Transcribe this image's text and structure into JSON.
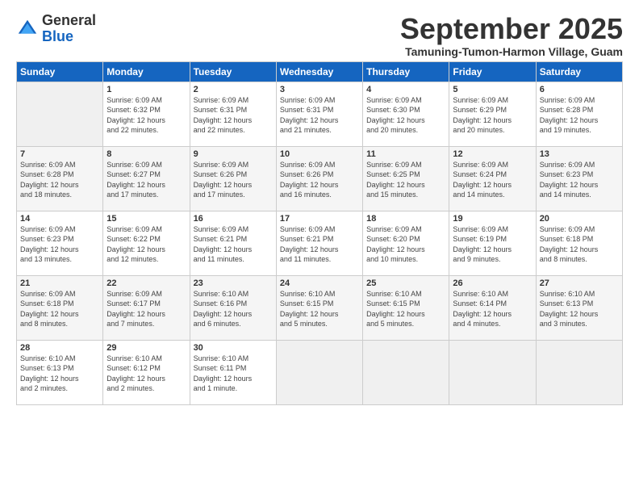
{
  "logo": {
    "general": "General",
    "blue": "Blue"
  },
  "header": {
    "month": "September 2025",
    "location": "Tamuning-Tumon-Harmon Village, Guam"
  },
  "days_of_week": [
    "Sunday",
    "Monday",
    "Tuesday",
    "Wednesday",
    "Thursday",
    "Friday",
    "Saturday"
  ],
  "weeks": [
    [
      {
        "day": "",
        "info": ""
      },
      {
        "day": "1",
        "info": "Sunrise: 6:09 AM\nSunset: 6:32 PM\nDaylight: 12 hours\nand 22 minutes."
      },
      {
        "day": "2",
        "info": "Sunrise: 6:09 AM\nSunset: 6:31 PM\nDaylight: 12 hours\nand 22 minutes."
      },
      {
        "day": "3",
        "info": "Sunrise: 6:09 AM\nSunset: 6:31 PM\nDaylight: 12 hours\nand 21 minutes."
      },
      {
        "day": "4",
        "info": "Sunrise: 6:09 AM\nSunset: 6:30 PM\nDaylight: 12 hours\nand 20 minutes."
      },
      {
        "day": "5",
        "info": "Sunrise: 6:09 AM\nSunset: 6:29 PM\nDaylight: 12 hours\nand 20 minutes."
      },
      {
        "day": "6",
        "info": "Sunrise: 6:09 AM\nSunset: 6:28 PM\nDaylight: 12 hours\nand 19 minutes."
      }
    ],
    [
      {
        "day": "7",
        "info": "Sunrise: 6:09 AM\nSunset: 6:28 PM\nDaylight: 12 hours\nand 18 minutes."
      },
      {
        "day": "8",
        "info": "Sunrise: 6:09 AM\nSunset: 6:27 PM\nDaylight: 12 hours\nand 17 minutes."
      },
      {
        "day": "9",
        "info": "Sunrise: 6:09 AM\nSunset: 6:26 PM\nDaylight: 12 hours\nand 17 minutes."
      },
      {
        "day": "10",
        "info": "Sunrise: 6:09 AM\nSunset: 6:26 PM\nDaylight: 12 hours\nand 16 minutes."
      },
      {
        "day": "11",
        "info": "Sunrise: 6:09 AM\nSunset: 6:25 PM\nDaylight: 12 hours\nand 15 minutes."
      },
      {
        "day": "12",
        "info": "Sunrise: 6:09 AM\nSunset: 6:24 PM\nDaylight: 12 hours\nand 14 minutes."
      },
      {
        "day": "13",
        "info": "Sunrise: 6:09 AM\nSunset: 6:23 PM\nDaylight: 12 hours\nand 14 minutes."
      }
    ],
    [
      {
        "day": "14",
        "info": "Sunrise: 6:09 AM\nSunset: 6:23 PM\nDaylight: 12 hours\nand 13 minutes."
      },
      {
        "day": "15",
        "info": "Sunrise: 6:09 AM\nSunset: 6:22 PM\nDaylight: 12 hours\nand 12 minutes."
      },
      {
        "day": "16",
        "info": "Sunrise: 6:09 AM\nSunset: 6:21 PM\nDaylight: 12 hours\nand 11 minutes."
      },
      {
        "day": "17",
        "info": "Sunrise: 6:09 AM\nSunset: 6:21 PM\nDaylight: 12 hours\nand 11 minutes."
      },
      {
        "day": "18",
        "info": "Sunrise: 6:09 AM\nSunset: 6:20 PM\nDaylight: 12 hours\nand 10 minutes."
      },
      {
        "day": "19",
        "info": "Sunrise: 6:09 AM\nSunset: 6:19 PM\nDaylight: 12 hours\nand 9 minutes."
      },
      {
        "day": "20",
        "info": "Sunrise: 6:09 AM\nSunset: 6:18 PM\nDaylight: 12 hours\nand 8 minutes."
      }
    ],
    [
      {
        "day": "21",
        "info": "Sunrise: 6:09 AM\nSunset: 6:18 PM\nDaylight: 12 hours\nand 8 minutes."
      },
      {
        "day": "22",
        "info": "Sunrise: 6:09 AM\nSunset: 6:17 PM\nDaylight: 12 hours\nand 7 minutes."
      },
      {
        "day": "23",
        "info": "Sunrise: 6:10 AM\nSunset: 6:16 PM\nDaylight: 12 hours\nand 6 minutes."
      },
      {
        "day": "24",
        "info": "Sunrise: 6:10 AM\nSunset: 6:15 PM\nDaylight: 12 hours\nand 5 minutes."
      },
      {
        "day": "25",
        "info": "Sunrise: 6:10 AM\nSunset: 6:15 PM\nDaylight: 12 hours\nand 5 minutes."
      },
      {
        "day": "26",
        "info": "Sunrise: 6:10 AM\nSunset: 6:14 PM\nDaylight: 12 hours\nand 4 minutes."
      },
      {
        "day": "27",
        "info": "Sunrise: 6:10 AM\nSunset: 6:13 PM\nDaylight: 12 hours\nand 3 minutes."
      }
    ],
    [
      {
        "day": "28",
        "info": "Sunrise: 6:10 AM\nSunset: 6:13 PM\nDaylight: 12 hours\nand 2 minutes."
      },
      {
        "day": "29",
        "info": "Sunrise: 6:10 AM\nSunset: 6:12 PM\nDaylight: 12 hours\nand 2 minutes."
      },
      {
        "day": "30",
        "info": "Sunrise: 6:10 AM\nSunset: 6:11 PM\nDaylight: 12 hours\nand 1 minute."
      },
      {
        "day": "",
        "info": ""
      },
      {
        "day": "",
        "info": ""
      },
      {
        "day": "",
        "info": ""
      },
      {
        "day": "",
        "info": ""
      }
    ]
  ]
}
